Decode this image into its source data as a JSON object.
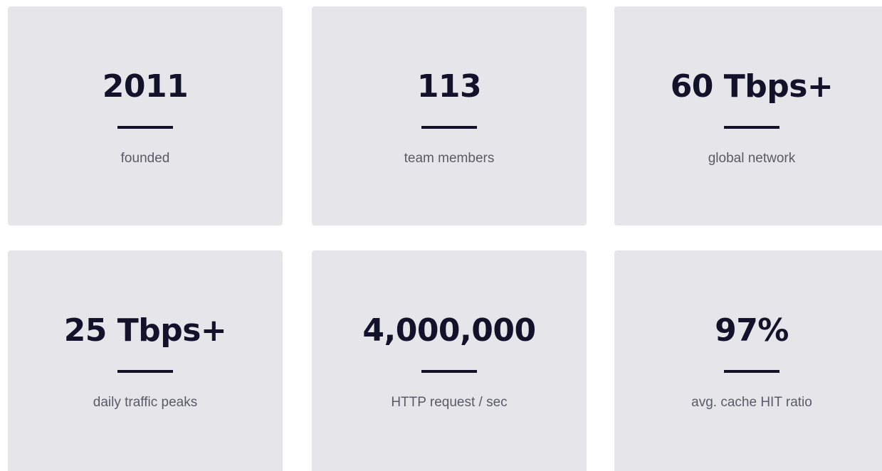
{
  "stats": [
    {
      "value": "2011",
      "label": "founded"
    },
    {
      "value": "113",
      "label": "team members"
    },
    {
      "value": "60 Tbps+",
      "label": "global network"
    },
    {
      "value": "25 Tbps+",
      "label": "daily traffic peaks"
    },
    {
      "value": "4,000,000",
      "label": "HTTP request / sec"
    },
    {
      "value": "97%",
      "label": "avg. cache HIT ratio"
    }
  ],
  "colors": {
    "card_background": "#e6e6ea",
    "value_text": "#14122a",
    "divider": "#14122a",
    "label_text": "#5a5a66"
  }
}
